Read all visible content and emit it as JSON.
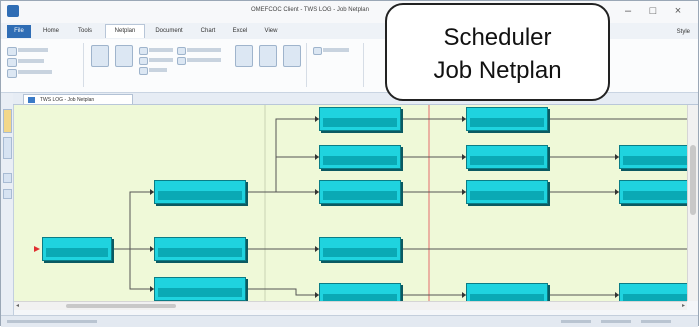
{
  "window": {
    "title": "OMEFCOC Client - TWS LOG - Job Netplan"
  },
  "ribbon": {
    "tabs": [
      "File",
      "Home",
      "Tools",
      "Netplan",
      "Document",
      "Chart",
      "Excel",
      "View"
    ],
    "active_tab": "Netplan",
    "style_label": "Style"
  },
  "document_tab": {
    "label": "TWS LOG - Job Netplan"
  },
  "callout": {
    "line1": "Scheduler",
    "line2": "Job Netplan"
  },
  "colors": {
    "job_fill": "#1fd3df",
    "job_border": "#0a7d86",
    "canvas_bg": "#eff9d8",
    "callout_border": "#222222",
    "link": "#555555",
    "start_marker": "#e03030"
  },
  "icons": [
    "app-icon",
    "minimize-icon",
    "maximize-icon",
    "close-icon",
    "document-icon",
    "arrow-left-icon",
    "arrow-right-icon"
  ]
}
